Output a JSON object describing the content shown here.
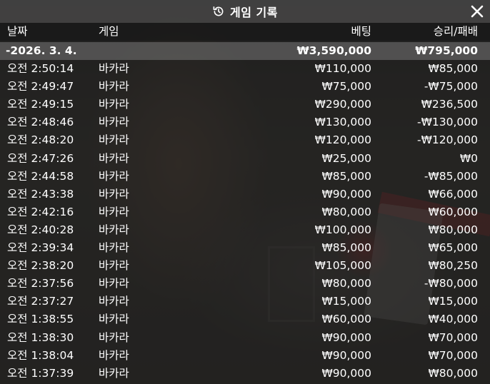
{
  "dialog": {
    "title": "게임 기록",
    "title_icon": "history-icon",
    "close_icon": "close-icon"
  },
  "table": {
    "headers": {
      "date": "날짜",
      "game": "게임",
      "bet": "베팅",
      "win_loss": "승리/패배"
    },
    "summary": {
      "date": "-2026. 3. 4.",
      "bet": "₩3,590,000",
      "win_loss": "₩795,000"
    },
    "rows": [
      {
        "time": "오전 2:50:14",
        "game": "바카라",
        "bet": "₩110,000",
        "win_loss": "₩85,000"
      },
      {
        "time": "오전 2:49:47",
        "game": "바카라",
        "bet": "₩75,000",
        "win_loss": "-₩75,000"
      },
      {
        "time": "오전 2:49:15",
        "game": "바카라",
        "bet": "₩290,000",
        "win_loss": "₩236,500"
      },
      {
        "time": "오전 2:48:46",
        "game": "바카라",
        "bet": "₩130,000",
        "win_loss": "-₩130,000"
      },
      {
        "time": "오전 2:48:20",
        "game": "바카라",
        "bet": "₩120,000",
        "win_loss": "-₩120,000"
      },
      {
        "time": "오전 2:47:26",
        "game": "바카라",
        "bet": "₩25,000",
        "win_loss": "₩0"
      },
      {
        "time": "오전 2:44:58",
        "game": "바카라",
        "bet": "₩85,000",
        "win_loss": "-₩85,000"
      },
      {
        "time": "오전 2:43:38",
        "game": "바카라",
        "bet": "₩90,000",
        "win_loss": "₩66,000"
      },
      {
        "time": "오전 2:42:16",
        "game": "바카라",
        "bet": "₩80,000",
        "win_loss": "₩60,000"
      },
      {
        "time": "오전 2:40:28",
        "game": "바카라",
        "bet": "₩100,000",
        "win_loss": "₩80,000"
      },
      {
        "time": "오전 2:39:34",
        "game": "바카라",
        "bet": "₩85,000",
        "win_loss": "₩65,000"
      },
      {
        "time": "오전 2:38:20",
        "game": "바카라",
        "bet": "₩105,000",
        "win_loss": "₩80,250"
      },
      {
        "time": "오전 2:37:56",
        "game": "바카라",
        "bet": "₩80,000",
        "win_loss": "-₩80,000"
      },
      {
        "time": "오전 2:37:27",
        "game": "바카라",
        "bet": "₩15,000",
        "win_loss": "₩15,000"
      },
      {
        "time": "오전 1:38:55",
        "game": "바카라",
        "bet": "₩60,000",
        "win_loss": "₩40,000"
      },
      {
        "time": "오전 1:38:30",
        "game": "바카라",
        "bet": "₩90,000",
        "win_loss": "₩70,000"
      },
      {
        "time": "오전 1:38:04",
        "game": "바카라",
        "bet": "₩90,000",
        "win_loss": "₩70,000"
      },
      {
        "time": "오전 1:37:39",
        "game": "바카라",
        "bet": "₩90,000",
        "win_loss": "₩80,000"
      }
    ]
  }
}
